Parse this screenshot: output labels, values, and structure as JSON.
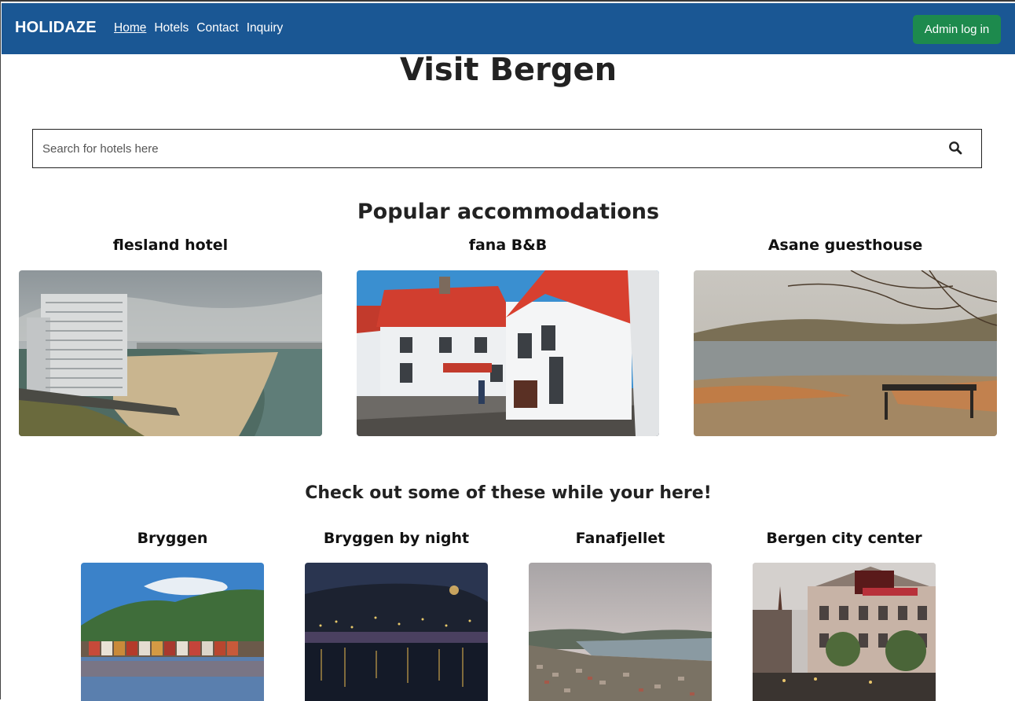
{
  "nav": {
    "brand": "HOLIDAZE",
    "links": [
      "Home",
      "Hotels",
      "Contact",
      "Inquiry"
    ],
    "admin_button": "Admin log in"
  },
  "hero": {
    "title": "Visit Bergen"
  },
  "search": {
    "placeholder": "Search for hotels here",
    "icon": "search-icon"
  },
  "popular": {
    "title": "Popular accommodations",
    "items": [
      {
        "name": "flesland hotel"
      },
      {
        "name": "fana B&B"
      },
      {
        "name": "Asane guesthouse"
      }
    ]
  },
  "attractions": {
    "title": "Check out some of these while your here!",
    "items": [
      {
        "name": "Bryggen"
      },
      {
        "name": "Bryggen by night"
      },
      {
        "name": "Fanafjellet"
      },
      {
        "name": "Bergen city center"
      }
    ]
  },
  "colors": {
    "navbar": "#1a5794",
    "admin_button": "#1d8a4d"
  }
}
